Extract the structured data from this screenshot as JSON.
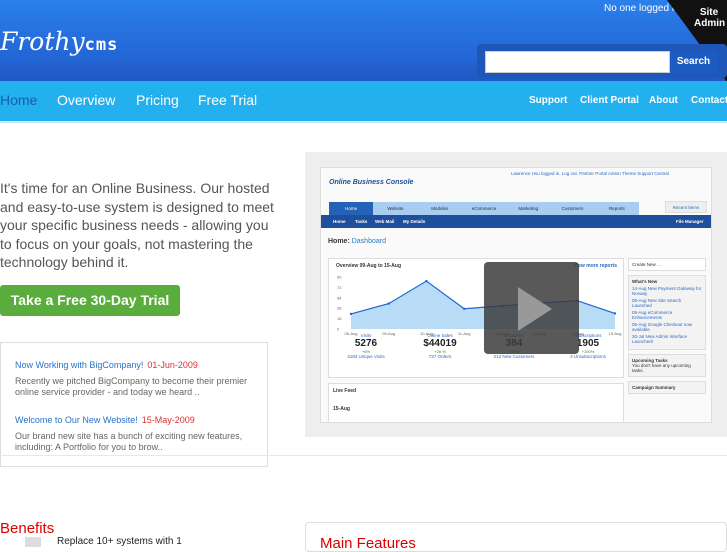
{
  "header": {
    "login_status": "No one logged in",
    "site_admin": "Site Admin",
    "logo_script": "Frothy",
    "logo_bold": "cms",
    "search_placeholder": "",
    "search_button": "Search"
  },
  "nav": {
    "left": [
      "Home",
      "Overview",
      "Pricing",
      "Free Trial"
    ],
    "right": [
      "Support",
      "Client Portal",
      "About",
      "Contact"
    ]
  },
  "intro": "It's time for an Online Business. Our hosted and easy-to-use system is designed to meet your specific business needs - allowing you to focus on your goals, not mastering the technology behind it.",
  "cta": "Take a Free 30-Day Trial",
  "news": [
    {
      "title": "Now Working with BigCompany!",
      "date": "01-Jun-2009",
      "summary": "Recently we pitched BigCompany to become their premier online service provider - and today we heard .."
    },
    {
      "title": "Welcome to Our New Website!",
      "date": "15-May-2009",
      "summary": "Our brand new site has a bunch of exciting new features, including: A Portfolio for you to brow.."
    }
  ],
  "benefits": {
    "title": "Benefits",
    "items": [
      "Replace 10+ systems with 1"
    ]
  },
  "features": {
    "title": "Main Features"
  },
  "screenshot": {
    "title": "Online Business Console",
    "top_links": "Lawrence Hsu logged in. Log out.   Partner Portal   Admin   Theme   Support Central",
    "tabs": [
      "Home",
      "Website",
      "Modules",
      "eCommerce",
      "Marketing",
      "Customers",
      "Reports"
    ],
    "recent": "Recent Items",
    "subnav": [
      "Home",
      "Tasks",
      "Web Mail",
      "My Details"
    ],
    "file_manager": "File Manager",
    "dash_prefix": "Home:",
    "dash_title": "Dashboard",
    "overview": "Overview 09-Aug to 15-Aug",
    "more_reports": "View more reports",
    "chart": {
      "x": [
        "08-Aug",
        "09-Aug",
        "10-Aug",
        "11-Aug",
        "12-Aug",
        "13-Aug",
        "14-Aug",
        "15-Aug"
      ],
      "values": [
        26,
        44,
        83,
        35,
        40,
        45,
        49,
        27
      ],
      "ylim": [
        0,
        90
      ],
      "yticks": [
        0,
        18,
        36,
        54,
        72,
        90
      ]
    },
    "stats": [
      {
        "label": "Visits",
        "value": "5276",
        "pct": "+6%",
        "sub": "4183 Unique Visits"
      },
      {
        "label": "Online Sales",
        "value": "$44019",
        "pct": "+26 %",
        "sub": "737 Orders"
      },
      {
        "label": "Enquiries",
        "value": "384",
        "pct": "+50%",
        "sub": "212 New Customers"
      },
      {
        "label": "Subscriptions",
        "value": "1905",
        "pct": "+100%",
        "sub": "3 Unsubscriptions"
      }
    ],
    "create_new": "Create New ...",
    "whats_new": "What's New",
    "whats_new_items": [
      "14-Aug New Payment Gateway for Norway",
      "08-Aug New Site Search Launched",
      "05-Aug eCommerce Enhancements",
      "05-Aug Google Checkout now available",
      "30-Jul New Admin Interface Launched!"
    ],
    "upcoming": "Upcoming Tasks",
    "upcoming_text": "You don't have any upcoming tasks.",
    "campaign": "Campaign Summary",
    "live_feed": "Live Feed",
    "live_date": "15-Aug"
  }
}
